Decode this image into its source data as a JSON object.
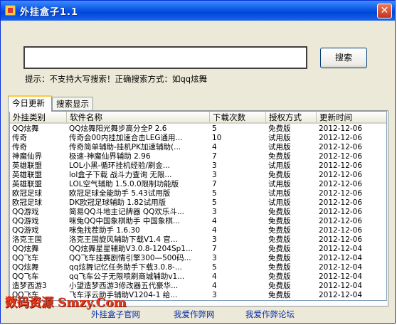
{
  "window": {
    "title": "外挂盒子1.1",
    "close_glyph": "✕"
  },
  "search": {
    "value": "",
    "button_label": "搜索",
    "hint": "提示：不支持大写搜索！正确搜索方式：如qq炫舞"
  },
  "tabs": [
    {
      "label": "今日更新",
      "active": true
    },
    {
      "label": "搜索显示",
      "active": false
    }
  ],
  "table": {
    "columns": [
      "外挂类别",
      "软件名称",
      "下载次数",
      "授权方式",
      "更新时间"
    ],
    "rows": [
      [
        "QQ炫舞",
        "QQ炫舞阳光舞步高分全P 2.6",
        "5",
        "免费版",
        "2012-12-06"
      ],
      [
        "传奇",
        "传奇会00内挂加速合击LEG通用...",
        "10",
        "试用版",
        "2012-12-06"
      ],
      [
        "传奇",
        "传奇简单辅助-挂机PK加速辅助(...",
        "4",
        "试用版",
        "2012-12-06"
      ],
      [
        "神魔仙界",
        "极速-神魔仙界辅助 2.96",
        "7",
        "免费版",
        "2012-12-06"
      ],
      [
        "英雄联盟",
        "LOL小黑-循环挂机经验/刷金...",
        "3",
        "试用版",
        "2012-12-06"
      ],
      [
        "英雄联盟",
        "lol盒子下载 战斗力查询 无限...",
        "3",
        "免费版",
        "2012-12-06"
      ],
      [
        "英雄联盟",
        "LOL空气辅助 1.5.0.0限制功能版",
        "7",
        "试用版",
        "2012-12-06"
      ],
      [
        "欧冠足球",
        "欧冠足球全能助手 5.43试用版",
        "5",
        "试用版",
        "2012-12-06"
      ],
      [
        "欧冠足球",
        "DK欧冠足球辅助 1.82试用版",
        "5",
        "试用版",
        "2012-12-06"
      ],
      [
        "QQ游戏",
        "简易QQ斗地主记牌器 QQ欢乐斗...",
        "3",
        "免费版",
        "2012-12-06"
      ],
      [
        "QQ游戏",
        "咪兔QQ中国象棋助手 中国象棋...",
        "4",
        "免费版",
        "2012-12-06"
      ],
      [
        "QQ游戏",
        "咪兔找茬助手 1.6.30",
        "4",
        "免费版",
        "2012-12-06"
      ],
      [
        "洛克王国",
        "洛克王国旋风辅助下载V1.4 官...",
        "3",
        "免费版",
        "2012-12-06"
      ],
      [
        "QQ炫舞",
        "QQ炫舞星星辅助V3.0.8-1204Sp1...",
        "7",
        "免费版",
        "2012-12-04"
      ],
      [
        "QQ飞车",
        "QQ飞车挂赛剧情引擎300—500码...",
        "3",
        "免费版",
        "2012-12-04"
      ],
      [
        "QQ炫舞",
        "qq炫舞记忆任务助手下载3.0.8-...",
        "5",
        "免费版",
        "2012-12-04"
      ],
      [
        "QQ飞车",
        "qq飞车公子无限喷刷商城辅助v1...",
        "4",
        "免费版",
        "2012-12-04"
      ],
      [
        "造梦西游3",
        "小望造梦西游3修改器五代豪华...",
        "4",
        "免费版",
        "2012-12-04"
      ],
      [
        "QQ飞车",
        "飞车浮云助手辅助V1204-1 给...",
        "3",
        "免费版",
        "2012-12-04"
      ]
    ]
  },
  "footer": {
    "links": [
      "外挂盒子官网",
      "我爱作弊网",
      "我爱作弊论坛"
    ]
  },
  "watermark": "数码资源 Smzy.Com"
}
